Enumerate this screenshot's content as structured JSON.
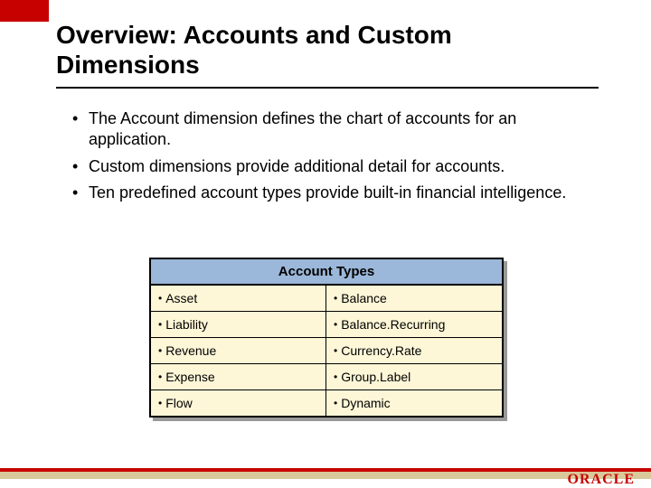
{
  "title": "Overview: Accounts and Custom Dimensions",
  "bullets": [
    "The Account dimension defines the chart of accounts for an application.",
    "Custom dimensions provide additional detail for accounts.",
    "Ten predefined account types provide built-in financial intelligence."
  ],
  "table": {
    "header": "Account Types",
    "rows": [
      {
        "left": "Asset",
        "right": "Balance"
      },
      {
        "left": "Liability",
        "right": "Balance.Recurring"
      },
      {
        "left": "Revenue",
        "right": "Currency.Rate"
      },
      {
        "left": "Expense",
        "right": "Group.Label"
      },
      {
        "left": "Flow",
        "right": "Dynamic"
      }
    ]
  },
  "logo": "ORACLE"
}
